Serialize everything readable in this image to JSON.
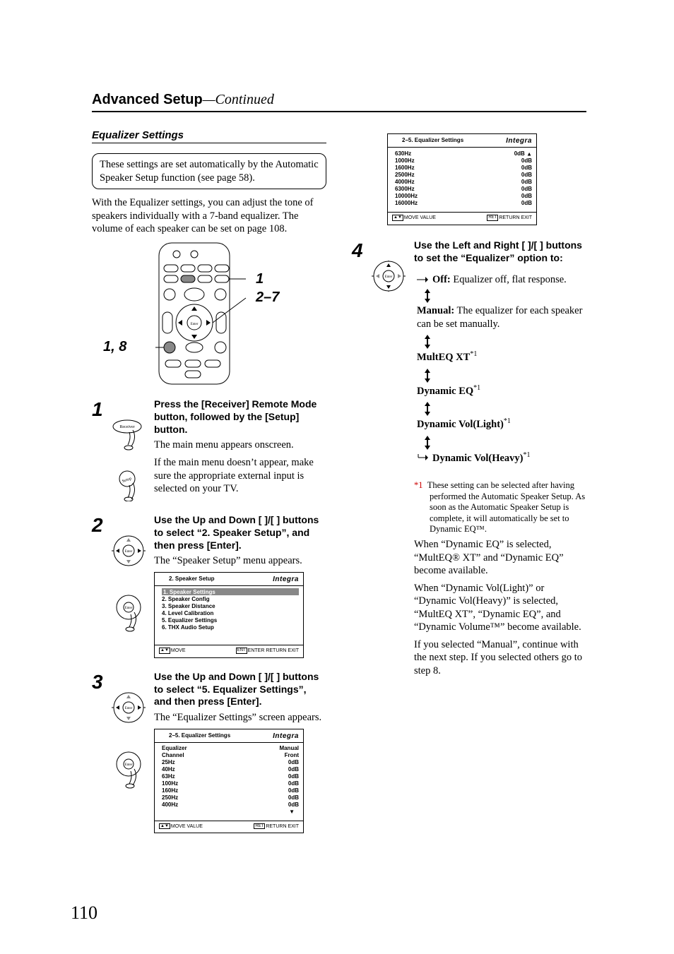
{
  "page_number": "110",
  "header": {
    "main": "Advanced Setup",
    "sub": "—Continued"
  },
  "section": {
    "title": "Equalizer Settings"
  },
  "note_box": "These settings are set automatically by the Automatic Speaker Setup function (see page 58).",
  "intro": "With the Equalizer settings, you can adjust the tone of speakers individually with a 7-band equalizer. The volume of each speaker can be set on page 108.",
  "remote_labels": {
    "a": "1",
    "b": "2–7",
    "c": "1, 8"
  },
  "steps": {
    "1": {
      "instr": "Press the [Receiver] Remote Mode button, followed by the [Setup] button.",
      "text": [
        "The main menu appears onscreen.",
        "If the main menu doesn’t appear, make sure the appropriate external input is selected on your TV."
      ]
    },
    "2": {
      "instr": "Use the Up and Down [   ]/[   ] buttons to select “2. Speaker Setup”, and then press [Enter].",
      "text": [
        "The “Speaker Setup” menu appears."
      ]
    },
    "3": {
      "instr": "Use the Up and Down [   ]/[   ] buttons to select “5. Equalizer Settings”, and then press [Enter].",
      "text": [
        "The “Equalizer Settings” screen appears."
      ]
    },
    "4": {
      "instr": "Use the Left and Right [   ]/[   ] buttons to set the “Equalizer” option to:"
    }
  },
  "flow": {
    "off_label": "Off:",
    "off_desc": " Equalizer off, flat response.",
    "manual_label": "Manual:",
    "manual_desc": " The equalizer for each speaker can be set manually.",
    "multeq": "MultEQ XT",
    "dyn_eq": "Dynamic EQ",
    "dyn_light": "Dynamic Vol(Light)",
    "dyn_heavy": "Dynamic Vol(Heavy)",
    "sup": "*1"
  },
  "footnote": {
    "mark": "*1",
    "text": "These setting can be selected after having performed the Automatic Speaker Setup. As soon as the Automatic Speaker Setup is complete, it will automatically be set to Dynamic EQ™."
  },
  "para": {
    "p1": "When “Dynamic EQ” is selected, “MultEQ® XT” and “Dynamic EQ” become available.",
    "p2": "When “Dynamic Vol(Light)” or “Dynamic Vol(Heavy)” is selected, “MultEQ XT”, “Dynamic EQ”, and “Dynamic Volume™” become available.",
    "p3": "If you selected “Manual”, continue with the next step. If you selected others go to step 8."
  },
  "osd1": {
    "title": "2.   Speaker Setup",
    "brand": "Integra",
    "items": [
      "1.   Speaker Settings",
      "2.   Speaker Config",
      "3.   Speaker Distance",
      "4.   Level Calibration",
      "5.   Equalizer Settings",
      "6.   THX Audio Setup"
    ],
    "foot_left": "MOVE",
    "foot_right": "ENTER       RETURN       EXIT"
  },
  "osd2": {
    "title": "2–5.   Equalizer Settings",
    "brand": "Integra",
    "rows": [
      {
        "k": "Equalizer",
        "v": "Manual"
      },
      {
        "k": "Channel",
        "v": "Front"
      },
      {
        "k": "25Hz",
        "v": "0dB"
      },
      {
        "k": "40Hz",
        "v": "0dB"
      },
      {
        "k": "63Hz",
        "v": "0dB"
      },
      {
        "k": "100Hz",
        "v": "0dB"
      },
      {
        "k": "160Hz",
        "v": "0dB"
      },
      {
        "k": "250Hz",
        "v": "0dB"
      },
      {
        "k": "400Hz",
        "v": "0dB"
      }
    ],
    "foot_left": "MOVE       VALUE",
    "foot_right": "RETURN       EXIT"
  },
  "osd3": {
    "title": "2–5.   Equalizer Settings",
    "brand": "Integra",
    "rows": [
      {
        "k": "630Hz",
        "v": "0dB"
      },
      {
        "k": "1000Hz",
        "v": "0dB"
      },
      {
        "k": "1600Hz",
        "v": "0dB"
      },
      {
        "k": "2500Hz",
        "v": "0dB"
      },
      {
        "k": "4000Hz",
        "v": "0dB"
      },
      {
        "k": "6300Hz",
        "v": "0dB"
      },
      {
        "k": "10000Hz",
        "v": "0dB"
      },
      {
        "k": "16000Hz",
        "v": "0dB"
      }
    ],
    "foot_left": "MOVE       VALUE",
    "foot_right": "RETURN       EXIT"
  }
}
